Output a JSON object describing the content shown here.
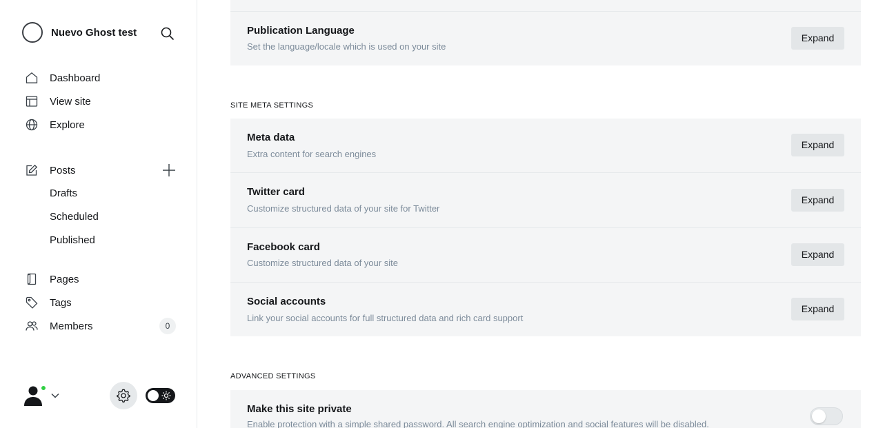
{
  "sidebar": {
    "brand_title": "Nuevo Ghost test",
    "nav": {
      "dashboard": "Dashboard",
      "view_site": "View site",
      "explore": "Explore",
      "posts": "Posts",
      "drafts": "Drafts",
      "scheduled": "Scheduled",
      "published": "Published",
      "pages": "Pages",
      "tags": "Tags",
      "members": "Members",
      "members_count": "0"
    },
    "icons": [
      "search-icon",
      "home-icon",
      "layout-icon",
      "globe-icon",
      "pencil-square-icon",
      "plus-icon",
      "page-icon",
      "tag-icon",
      "users-icon",
      "avatar-icon",
      "chevron-down-icon",
      "gear-icon",
      "sun-icon"
    ],
    "status_color": "#30cf43"
  },
  "main": {
    "top_card": {
      "title": "Publication Language",
      "description": "Set the language/locale which is used on your site",
      "button": "Expand"
    },
    "site_meta": {
      "heading": "SITE META SETTINGS",
      "rows": [
        {
          "title": "Meta data",
          "description": "Extra content for search engines",
          "button": "Expand"
        },
        {
          "title": "Twitter card",
          "description": "Customize structured data of your site for Twitter",
          "button": "Expand"
        },
        {
          "title": "Facebook card",
          "description": "Customize structured data of your site",
          "button": "Expand"
        },
        {
          "title": "Social accounts",
          "description": "Link your social accounts for full structured data and rich card support",
          "button": "Expand"
        }
      ]
    },
    "advanced": {
      "heading": "ADVANCED SETTINGS",
      "private": {
        "title": "Make this site private",
        "description": "Enable protection with a simple shared password. All search engine optimization and social features will be disabled.",
        "enabled": false
      }
    }
  }
}
